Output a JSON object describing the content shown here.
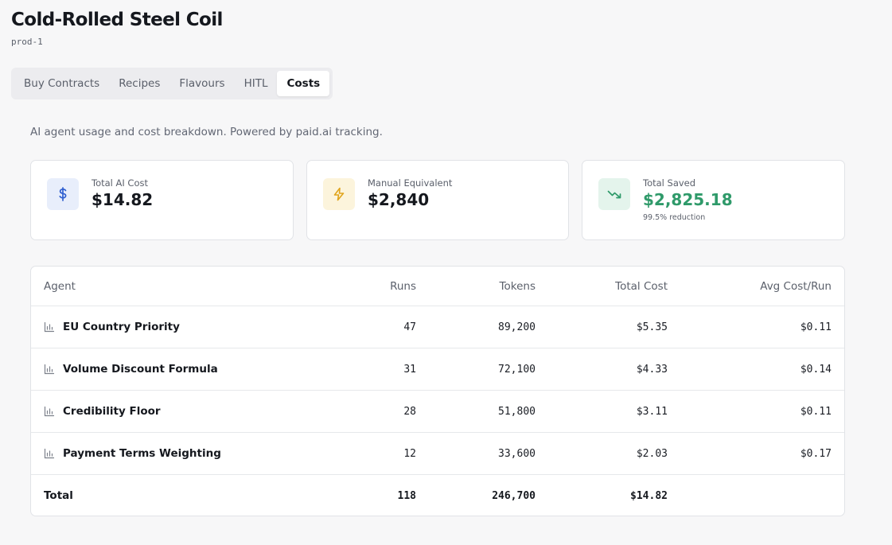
{
  "header": {
    "title": "Cold-Rolled Steel Coil",
    "product_id": "prod-1"
  },
  "tabs": [
    {
      "label": "Buy Contracts",
      "active": false
    },
    {
      "label": "Recipes",
      "active": false
    },
    {
      "label": "Flavours",
      "active": false
    },
    {
      "label": "HITL",
      "active": false
    },
    {
      "label": "Costs",
      "active": true
    }
  ],
  "description": "AI agent usage and cost breakdown. Powered by paid.ai tracking.",
  "cards": [
    {
      "label": "Total AI Cost",
      "value": "$14.82",
      "icon": "dollar-icon",
      "value_color": "#15181e",
      "icon_bg": "#e8eefb",
      "icon_color": "#2f5fcf"
    },
    {
      "label": "Manual Equivalent",
      "value": "$2,840",
      "icon": "lightning-icon",
      "value_color": "#15181e",
      "icon_bg": "#fcf4dc",
      "icon_color": "#e0a41c"
    },
    {
      "label": "Total Saved",
      "value": "$2,825.18",
      "note": "99.5% reduction",
      "icon": "trending-down-icon",
      "value_color": "#2f9a6a",
      "icon_bg": "#e4f4ec",
      "icon_color": "#2f9a6a"
    }
  ],
  "table": {
    "headers": {
      "agent": "Agent",
      "runs": "Runs",
      "tokens": "Tokens",
      "total_cost": "Total Cost",
      "avg_cost": "Avg Cost/Run"
    },
    "rows": [
      {
        "agent": "EU Country Priority",
        "runs": "47",
        "tokens": "89,200",
        "total_cost": "$5.35",
        "avg_cost": "$0.11"
      },
      {
        "agent": "Volume Discount Formula",
        "runs": "31",
        "tokens": "72,100",
        "total_cost": "$4.33",
        "avg_cost": "$0.14"
      },
      {
        "agent": "Credibility Floor",
        "runs": "28",
        "tokens": "51,800",
        "total_cost": "$3.11",
        "avg_cost": "$0.11"
      },
      {
        "agent": "Payment Terms Weighting",
        "runs": "12",
        "tokens": "33,600",
        "total_cost": "$2.03",
        "avg_cost": "$0.17"
      }
    ],
    "total": {
      "label": "Total",
      "runs": "118",
      "tokens": "246,700",
      "total_cost": "$14.82"
    }
  }
}
